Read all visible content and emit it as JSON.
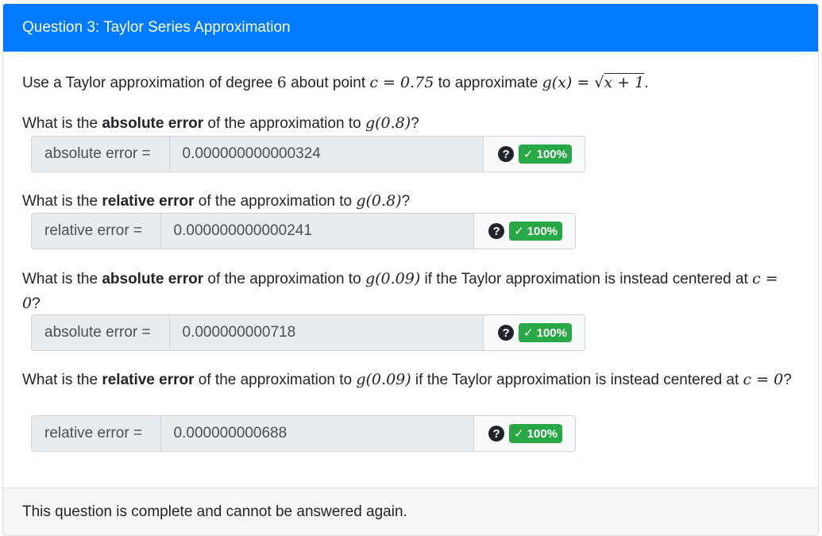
{
  "header": {
    "title": "Question 3: Taylor Series Approximation"
  },
  "intro": {
    "part1": "Use a Taylor approximation of degree ",
    "degree": "6",
    "part2": " about point ",
    "c_expr": "c = 0.75",
    "part3": " to approximate ",
    "g_lhs": "g(x) = ",
    "sqrt_sign": "√",
    "sqrt_arg": "x + 1",
    "period": "."
  },
  "questions": [
    {
      "prefix": "What is the ",
      "bold": "absolute error",
      "suffix": " of the approximation to ",
      "math": "g(0.8)",
      "tail": "?",
      "label": "absolute error =",
      "value": "0.000000000000324",
      "status": "100%"
    },
    {
      "prefix": "What is the ",
      "bold": "relative error",
      "suffix": " of the approximation to ",
      "math": "g(0.8)",
      "tail": "?",
      "label": "relative error =",
      "value": "0.000000000000241",
      "status": "100%"
    },
    {
      "prefix": "What is the ",
      "bold": "absolute error",
      "suffix": " of the approximation to ",
      "math": "g(0.09)",
      "tail": " if the Taylor approximation is instead centered at ",
      "math2": "c = 0",
      "tail2": "?",
      "label": "absolute error =",
      "value": "0.000000000718",
      "status": "100%"
    },
    {
      "prefix": "What is the ",
      "bold": "relative error",
      "suffix": " of the approximation to ",
      "math": "g(0.09)",
      "tail": " if the Taylor approximation is instead centered at ",
      "math2": "c = 0",
      "tail2": "?",
      "label": "relative error =",
      "value": "0.000000000688",
      "status": "100%"
    }
  ],
  "icons": {
    "help": "question-circle-icon",
    "check": "check-icon"
  },
  "colors": {
    "header": "#007bff",
    "badge": "#28a745"
  },
  "footer": {
    "text": "This question is complete and cannot be answered again."
  }
}
